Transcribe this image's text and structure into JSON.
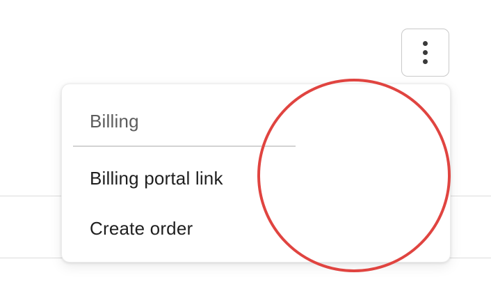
{
  "toolbar": {
    "more_actions_icon": "more-vertical-icon"
  },
  "menu": {
    "section_label": "Billing",
    "items": [
      {
        "label": "Billing portal link"
      },
      {
        "label": "Create order"
      }
    ]
  },
  "annotation": {
    "shape": "circle",
    "color": "#e04440"
  }
}
